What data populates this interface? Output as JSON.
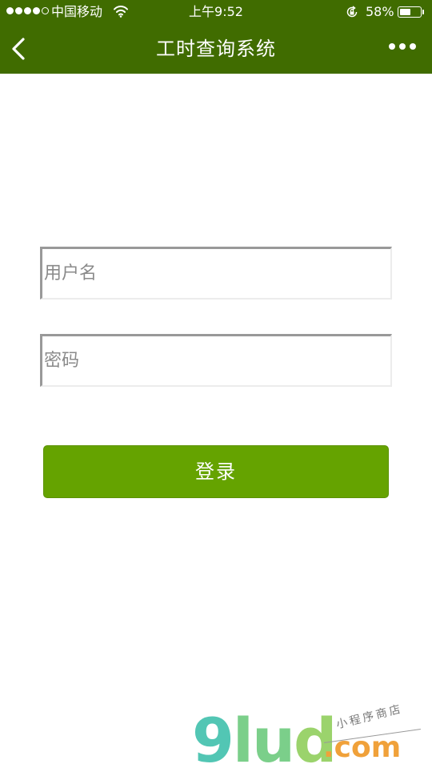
{
  "status_bar": {
    "carrier": "中国移动",
    "time": "上午9:52",
    "battery_percent": "58%",
    "battery_level": 0.58,
    "signal_bars_filled": 4,
    "signal_bars_total": 5
  },
  "nav": {
    "title": "工时查询系统",
    "back_icon": "chevron-left-icon",
    "more_icon": "more-dots-icon"
  },
  "form": {
    "username": {
      "placeholder": "用户名",
      "value": ""
    },
    "password": {
      "placeholder": "密码",
      "value": ""
    },
    "login_label": "登录"
  },
  "watermark": {
    "logo_prefix": "9",
    "logo_mid": "lu",
    "logo_end": "d",
    "dotcom": ".com",
    "tagline": "小程序商店"
  },
  "colors": {
    "header": "#406c00",
    "button": "#65a300"
  }
}
